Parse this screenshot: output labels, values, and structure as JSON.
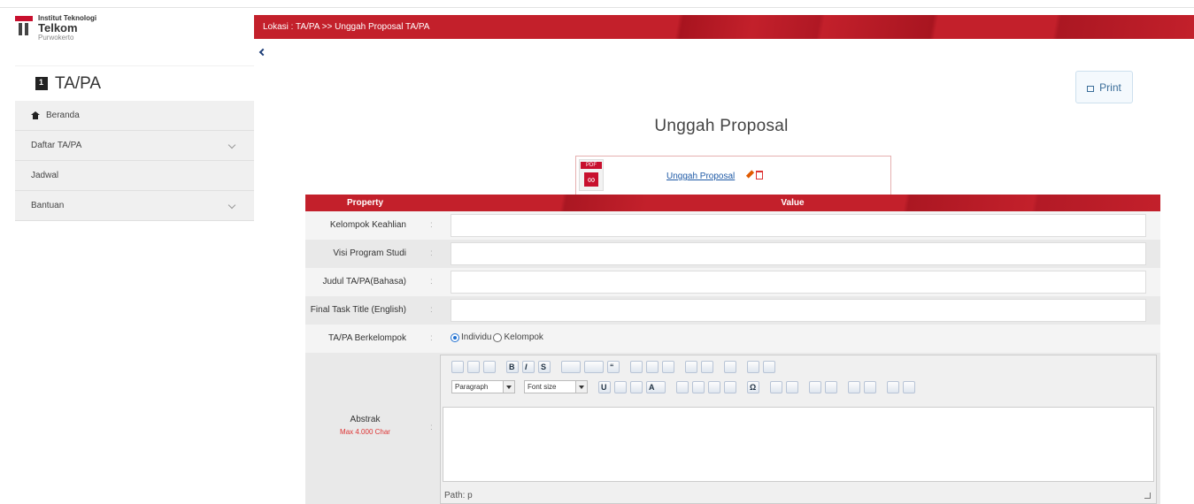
{
  "logo": {
    "line1": "Institut Teknologi",
    "line2": "Telkom",
    "line3": "Purwokerto"
  },
  "module": {
    "title": "TA/PA",
    "icon": "book-icon"
  },
  "sidebar": {
    "items": [
      {
        "label": "Beranda",
        "icon": "home-icon",
        "expandable": false
      },
      {
        "label": "Daftar TA/PA",
        "expandable": true
      },
      {
        "label": "Jadwal",
        "expandable": false
      },
      {
        "label": "Bantuan",
        "expandable": true
      }
    ]
  },
  "header": {
    "breadcrumb": "Lokasi : TA/PA >> Unggah Proposal TA/PA",
    "accent": "#c3202b"
  },
  "actions": {
    "print_label": "Print"
  },
  "page": {
    "title": "Unggah Proposal"
  },
  "upload": {
    "pdf_tag": "PDF",
    "link_label": "Unggah Proposal"
  },
  "table": {
    "header_property": "Property",
    "header_value": "Value",
    "rows": [
      {
        "label": "Kelompok Keahlian",
        "value": ""
      },
      {
        "label": "Visi Program Studi",
        "value": ""
      },
      {
        "label": "Judul TA/PA(Bahasa)",
        "value": ""
      },
      {
        "label": "Final Task Title (English)",
        "value": ""
      },
      {
        "label": "TA/PA Berkelompok",
        "options": [
          "Individu",
          "Kelompok"
        ],
        "selected": "Individu"
      }
    ],
    "colon": ":",
    "abstract": {
      "label": "Abstrak",
      "sublabel": "Max 4.000 Char",
      "format_select": "Paragraph",
      "size_select": "Font size",
      "path_label": "Path: p"
    }
  }
}
